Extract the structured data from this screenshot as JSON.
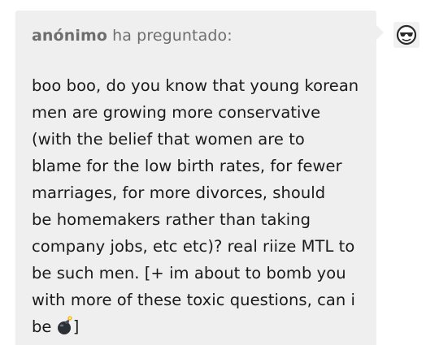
{
  "ask": {
    "asker": "anónimo",
    "verb": "ha preguntado:",
    "lines": [
      "boo boo, do you know that young korean",
      "men are growing more conservative",
      "(with the belief that women are to",
      "blame for the low birth rates, for fewer",
      "marriages, for more divorces, should",
      "be homemakers rather than taking",
      "company jobs, etc etc)? real riize MTL to",
      "be such men. [+ im about to bomb you",
      "with more of these toxic questions, can i"
    ],
    "last_line_prefix": "be ",
    "last_line_suffix": "]",
    "emoji": "bomb-emoji"
  },
  "avatar": {
    "icon": "sunglasses-smiley-avatar"
  },
  "colors": {
    "bubble_bg": "#efefef",
    "header_text": "#6e6e6e",
    "body_text": "#1a1a1a"
  }
}
